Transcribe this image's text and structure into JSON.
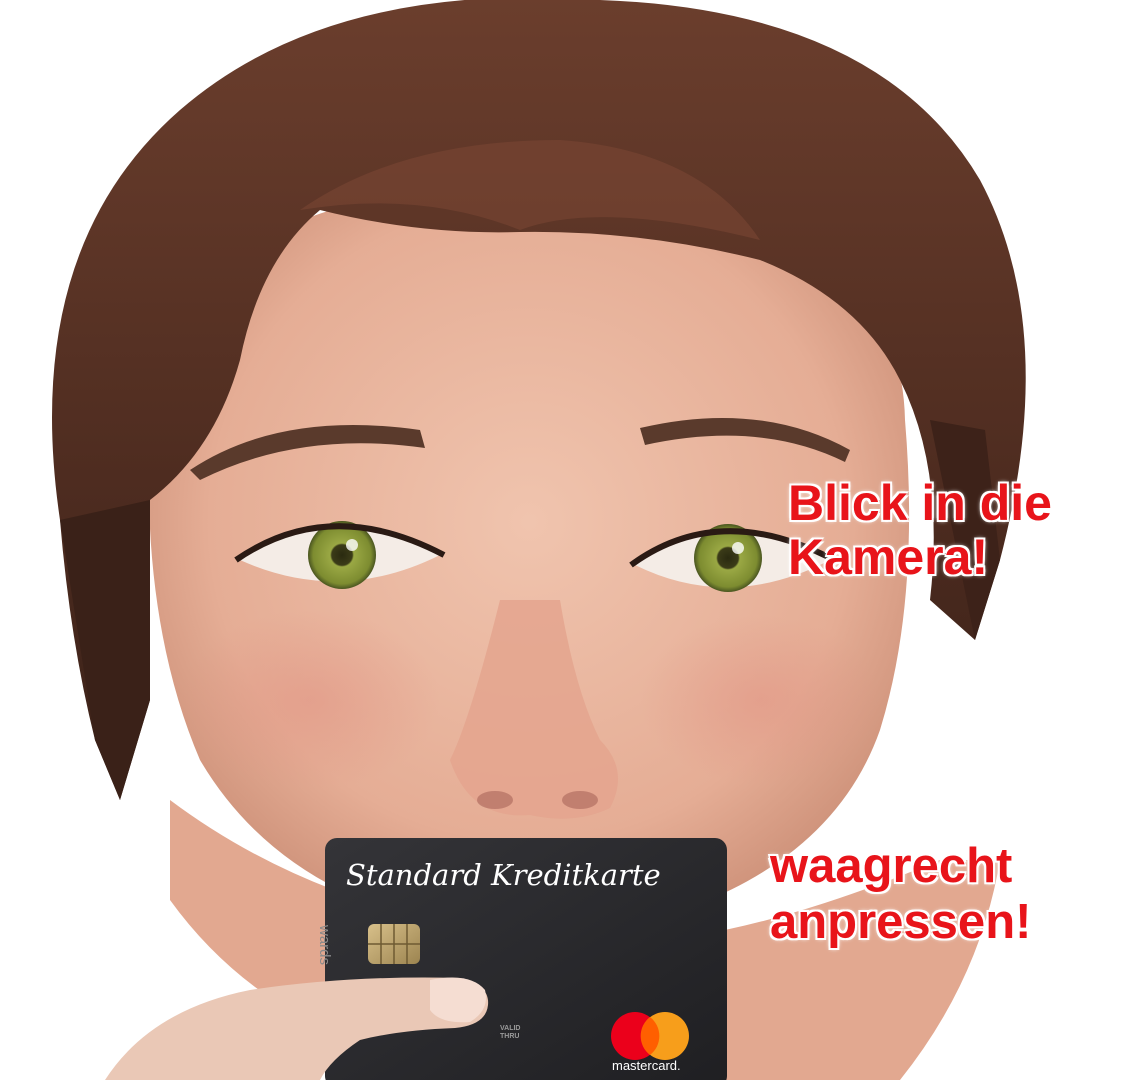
{
  "callouts": {
    "look_line1": "Blick in die",
    "look_line2": "Kamera!",
    "press_line1": "waagrecht",
    "press_line2": "anpressen!"
  },
  "card": {
    "title": "Standard Kreditkarte",
    "side_text": "wards",
    "valid_line1": "VALID",
    "valid_line2": "THRU",
    "brand": "mastercard.",
    "colors": {
      "card_body": "#2b2b2e",
      "mc_red": "#eb001b",
      "mc_orange": "#f79e1b",
      "mc_overlap": "#ff5f00"
    }
  },
  "colors": {
    "callout_text": "#e8141a",
    "hair": "#5a3426",
    "skin": "#e9b49e",
    "iris": "#8a9a3a"
  }
}
